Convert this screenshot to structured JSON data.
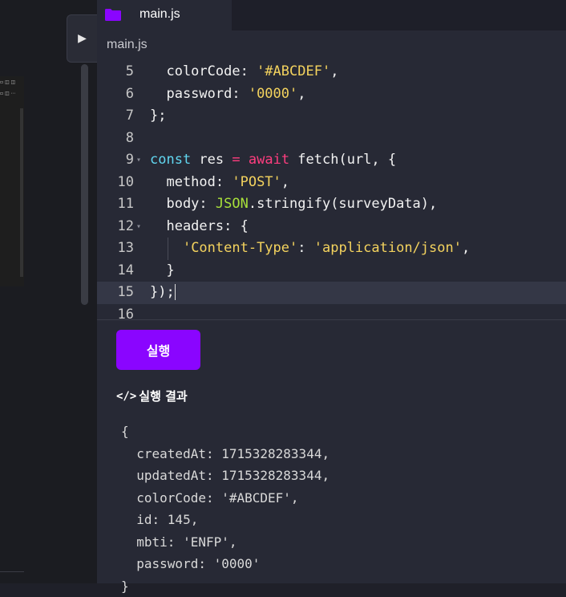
{
  "tab": {
    "label": "main.js",
    "icon": "folder-icon",
    "icon_color": "#8a05ff"
  },
  "breadcrumb": "main.js",
  "code_lines": [
    {
      "num": "5",
      "parts": [
        [
          "  colorCode: ",
          ""
        ],
        [
          "'#ABCDEF'",
          "str"
        ],
        [
          ",",
          ""
        ]
      ]
    },
    {
      "num": "6",
      "parts": [
        [
          "  password: ",
          ""
        ],
        [
          "'0000'",
          "str"
        ],
        [
          ",",
          ""
        ]
      ]
    },
    {
      "num": "7",
      "parts": [
        [
          "};",
          ""
        ]
      ]
    },
    {
      "num": "8",
      "parts": []
    },
    {
      "num": "9",
      "fold": true,
      "parts": [
        [
          "const",
          "kw"
        ],
        [
          " res ",
          ""
        ],
        [
          "=",
          "aw"
        ],
        [
          " ",
          ""
        ],
        [
          "await",
          "aw"
        ],
        [
          " fetch(url, {",
          ""
        ]
      ]
    },
    {
      "num": "10",
      "parts": [
        [
          "  method: ",
          ""
        ],
        [
          "'POST'",
          "str"
        ],
        [
          ",",
          ""
        ]
      ]
    },
    {
      "num": "11",
      "parts": [
        [
          "  body: ",
          ""
        ],
        [
          "JSON",
          "jsn"
        ],
        [
          ".stringify(surveyData),",
          ""
        ]
      ]
    },
    {
      "num": "12",
      "fold": true,
      "parts": [
        [
          "  headers: {",
          ""
        ]
      ]
    },
    {
      "num": "13",
      "guide": true,
      "parts": [
        [
          "    ",
          ""
        ],
        [
          "'Content-Type'",
          "str"
        ],
        [
          ": ",
          ""
        ],
        [
          "'application/json'",
          "str"
        ],
        [
          ",",
          ""
        ]
      ]
    },
    {
      "num": "14",
      "parts": [
        [
          "  }",
          ""
        ]
      ]
    },
    {
      "num": "15",
      "active": true,
      "cursor": true,
      "parts": [
        [
          "});",
          ""
        ]
      ]
    },
    {
      "num": "16",
      "parts": []
    }
  ],
  "run_button": {
    "label": "실행"
  },
  "result": {
    "title": "실행 결과",
    "icon": "code-icon",
    "lines": [
      "{",
      "  createdAt: 1715328283344,",
      "  updatedAt: 1715328283344,",
      "  colorCode: '#ABCDEF',",
      "  id: 145,",
      "  mbti: 'ENFP',",
      "  password: '0000'",
      "}"
    ]
  }
}
